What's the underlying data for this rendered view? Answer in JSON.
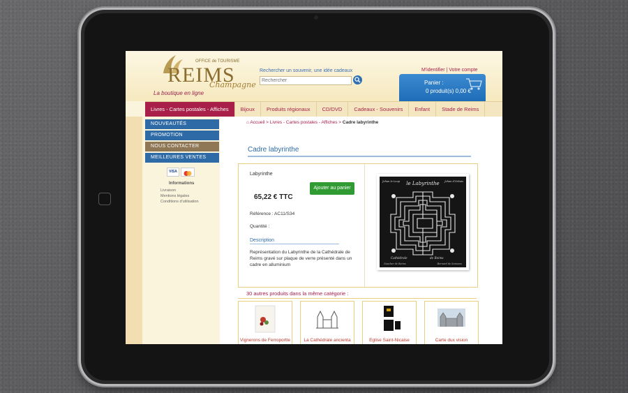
{
  "header": {
    "logo_small": "OFFICE de TOURISME",
    "logo_main": "REIMS",
    "logo_script": "Champagne",
    "tagline": "La boutique en ligne",
    "search_label": "Rechercher un souvenir, une idée cadeaux",
    "search_placeholder": "Rechercher",
    "account_links": "M'identifier | Votre compte",
    "cart_title": "Panier :",
    "cart_count": "0 produit(s) 0,00 €"
  },
  "nav": [
    {
      "label": "Livres - Cartes postales - Affiches",
      "active": true
    },
    {
      "label": "Bijoux"
    },
    {
      "label": "Produits régionaux"
    },
    {
      "label": "CD/DVD"
    },
    {
      "label": "Cadeaux - Souvenirs"
    },
    {
      "label": "Enfant"
    },
    {
      "label": "Stade de Reims"
    }
  ],
  "sidebar": {
    "menu": [
      "Nouveautés",
      "Promotion",
      "Nous Contacter",
      "Meilleures Ventes"
    ],
    "payment": "VISA",
    "info_title": "Informations",
    "info_links": [
      "Livraison",
      "Mentions légales",
      "Conditions d'utilisation"
    ]
  },
  "breadcrumb": {
    "home": "Accueil",
    "sep": ">",
    "category": "Livres - Cartes postales - Affiches",
    "current": "Cadre labyrinthe"
  },
  "product": {
    "title": "Cadre labyrinthe",
    "name": "Labyrinthe",
    "price": "65,22 € TTC",
    "add_button": "Ajouter au panier",
    "reference": "Référence : AC11/S34",
    "quantity": "Quantité :",
    "desc_title": "Description",
    "description": "Représentation du Labyrinthe de la Cathédrale de Reims gravé sur plaque de verre présenté dans un cadre en alluminium",
    "image_title": "le Labyrinthe",
    "image_corner_left": "Jehan le Loup",
    "image_corner_right": "Jehan d'Orbais",
    "image_bottom_left": "Cathédrale",
    "image_bottom_right": "de Reims",
    "image_sub_left": "Gaucher de Reims",
    "image_sub_right": "Bernard de Soissons"
  },
  "related": {
    "title": "30 autres produits dans la même catégorie :",
    "items": [
      {
        "label": "Vignerons de Ferroportte"
      },
      {
        "label": "La Cathédrale ancienta"
      },
      {
        "label": "Eglise Saint-Nicaise"
      },
      {
        "label": "Carte dux vision"
      }
    ]
  },
  "colors": {
    "accent": "#a8204a",
    "blue": "#2e6aa5",
    "button_green": "#2f9b32"
  }
}
